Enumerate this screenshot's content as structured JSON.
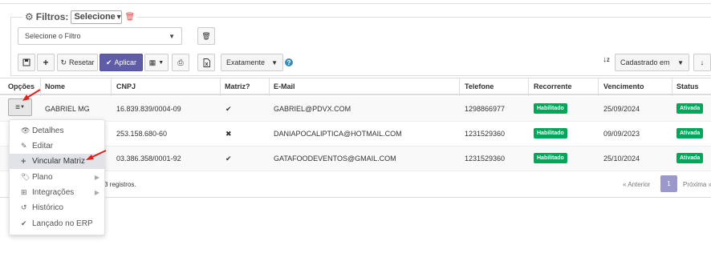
{
  "filters": {
    "title": "Filtros:",
    "legend_select": "Selecione",
    "filter_select": "Selecione o Filtro"
  },
  "toolbar": {
    "reset_label": "Resetar",
    "apply_label": "Aplicar",
    "match_select": "Exatamente",
    "sort_select": "Cadastrado em"
  },
  "table": {
    "headers": [
      "Opções",
      "Nome",
      "CNPJ",
      "Matriz?",
      "E-Mail",
      "Telefone",
      "Recorrente",
      "Vencimento",
      "Status"
    ],
    "rows": [
      {
        "nome": "GABRIEL MG",
        "cnpj": "16.839.839/0004-09",
        "matriz": "✔",
        "email": "GABRIEL@PDVX.COM",
        "telefone": "1298866977",
        "recorrente": "Habilitado",
        "vencimento": "25/09/2024",
        "status": "Ativada"
      },
      {
        "nome": "",
        "cnpj": "253.158.680-60",
        "matriz": "✖",
        "email": "DANIAPOCALIPTICA@HOTMAIL.COM",
        "telefone": "1231529360",
        "recorrente": "Habilitado",
        "vencimento": "09/09/2023",
        "status": "Ativada"
      },
      {
        "nome": "",
        "cnpj": "03.386.358/0001-92",
        "matriz": "✔",
        "email": "GATAFOODEVENTOS@GMAIL.COM",
        "telefone": "1231529360",
        "recorrente": "Habilitado",
        "vencimento": "25/10/2024",
        "status": "Ativada"
      }
    ],
    "records_text": "3 registros.",
    "pager": {
      "prev": "« Anterior",
      "current": "1",
      "next": "Próxima »"
    }
  },
  "menu": {
    "items": [
      {
        "label": "Detalhes",
        "icon": "eye-icon"
      },
      {
        "label": "Editar",
        "icon": "pencil-icon"
      },
      {
        "label": "Vincular Matriz",
        "icon": "plus-icon"
      },
      {
        "label": "Plano",
        "icon": "tag-icon"
      },
      {
        "label": "Integrações",
        "icon": "sitemap-icon"
      },
      {
        "label": "Histórico",
        "icon": "history-icon"
      },
      {
        "label": "Lançado no ERP",
        "icon": "check-icon"
      }
    ]
  },
  "colors": {
    "primary": "#605ca8",
    "success": "#00a65a",
    "danger": "#d9534f",
    "info": "#3c8dbc",
    "annotation": "#e0201b"
  }
}
